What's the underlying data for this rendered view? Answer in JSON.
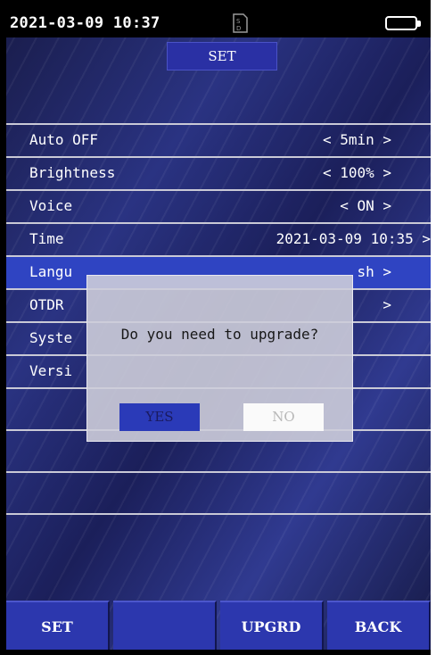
{
  "status_bar": {
    "datetime": "2021-03-09 10:37",
    "icons": [
      "sd-card-icon",
      "battery-icon"
    ]
  },
  "header": {
    "title": "SET"
  },
  "settings": [
    {
      "label": "Auto OFF",
      "value": "< 5min >"
    },
    {
      "label": "Brightness",
      "value": "< 100% >"
    },
    {
      "label": "Voice",
      "value": "< ON >"
    },
    {
      "label": "Time",
      "value": "2021-03-09 10:35 >"
    },
    {
      "label": "Langu",
      "value": "sh >"
    },
    {
      "label": "OTDR",
      "value": ">"
    },
    {
      "label": "Syste",
      "value": ""
    },
    {
      "label": "Versi",
      "value": ""
    }
  ],
  "dialog": {
    "message": "Do you need to upgrade?",
    "yes_label": "YES",
    "no_label": "NO"
  },
  "softkeys": [
    "SET",
    "",
    "UPGRD",
    "BACK"
  ],
  "colors": {
    "background": "#232a6e",
    "selected_row": "#2f44c2",
    "softkey": "#2c37ae",
    "dialog": "#cdcdda"
  }
}
